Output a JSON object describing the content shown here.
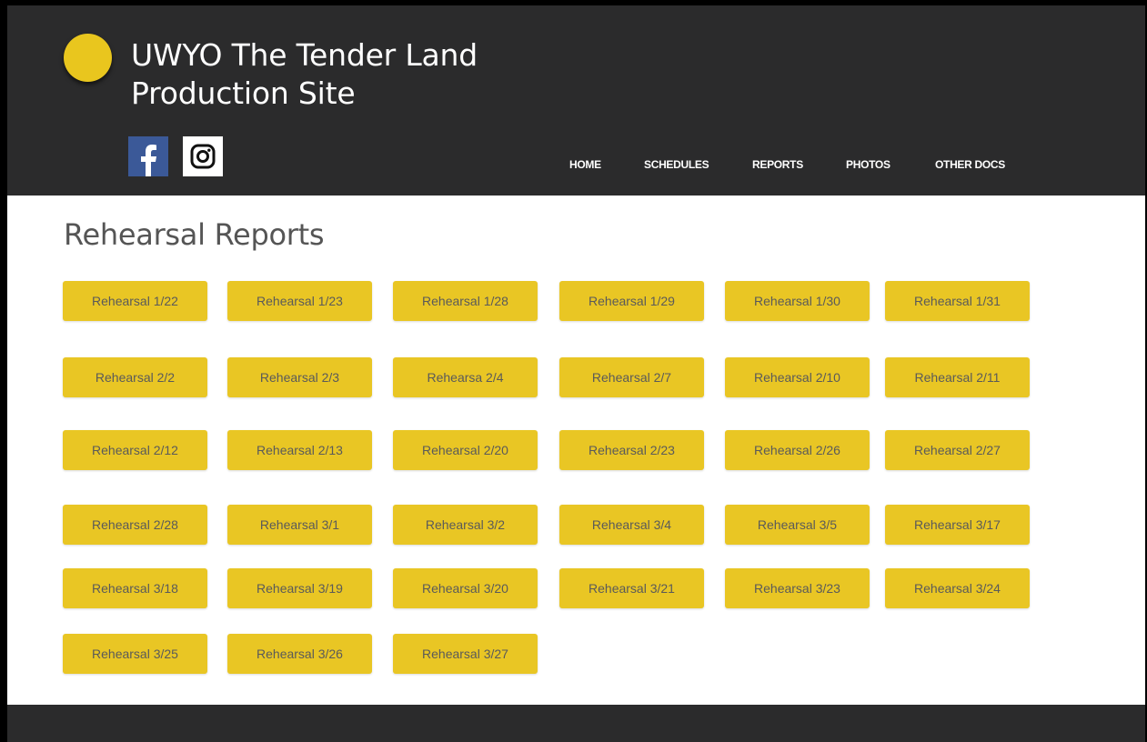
{
  "site": {
    "title": "UWYO The Tender Land Production Site"
  },
  "social": {
    "facebook_icon": "facebook-icon",
    "instagram_icon": "instagram-icon"
  },
  "nav": {
    "items": [
      "HOME",
      "SCHEDULES",
      "REPORTS",
      "PHOTOS",
      "OTHER DOCS"
    ]
  },
  "main": {
    "title": "Rehearsal Reports",
    "rows": [
      [
        "Rehearsal 1/22",
        "Rehearsal 1/23",
        "Rehearsal 1/28",
        "Rehearsal 1/29",
        "Rehearsal 1/30",
        "Rehearsal 1/31"
      ],
      [
        "Rehearsal 2/2",
        "Rehearsal 2/3",
        "Rehearsa 2/4",
        "Rehearsal 2/7",
        "Rehearsal 2/10",
        "Rehearsal 2/11"
      ],
      [
        "Rehearsal 2/12",
        "Rehearsal 2/13",
        "Rehearsal 2/20",
        "Rehearsal 2/23",
        "Rehearsal 2/26",
        "Rehearsal 2/27"
      ],
      [
        "Rehearsal 2/28",
        "Rehearsal 3/1",
        "Rehearsal 3/2",
        "Rehearsal 3/4",
        "Rehearsal 3/5",
        "Rehearsal 3/17"
      ],
      [
        "Rehearsal 3/18",
        "Rehearsal 3/19",
        "Rehearsal 3/20",
        "Rehearsal 3/21",
        "Rehearsal 3/23",
        "Rehearsal 3/24"
      ],
      [
        "Rehearsal 3/25",
        "Rehearsal 3/26",
        "Rehearsal 3/27"
      ]
    ]
  },
  "colors": {
    "header_bg": "#2b2b2c",
    "accent_yellow": "#e9c624",
    "facebook_blue": "#3b5998",
    "button_text": "#5a5a5a",
    "title_text": "#555555"
  }
}
